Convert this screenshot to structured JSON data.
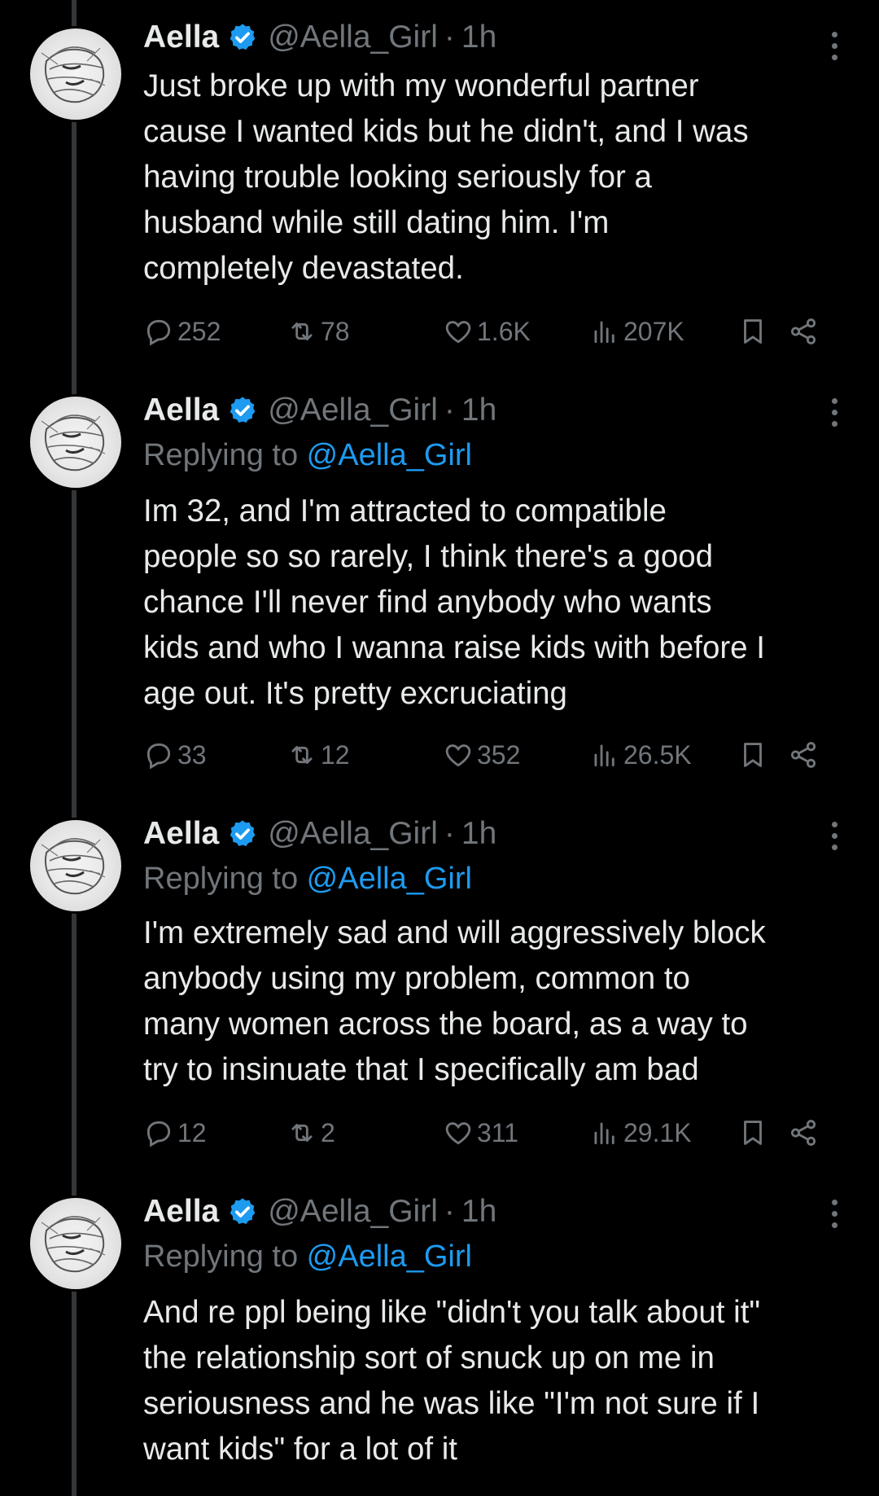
{
  "tweets": [
    {
      "name": "Aella",
      "handle": "@Aella_Girl",
      "separator": "·",
      "time": "1h",
      "replying_to": null,
      "text": "Just broke up with my wonderful partner\ncause I wanted kids but he didn't, and I was\nhaving trouble looking seriously for a\nhusband while still dating him. I'm\ncompletely devastated.",
      "replies": "252",
      "retweets": "78",
      "likes": "1.6K",
      "views": "207K"
    },
    {
      "name": "Aella",
      "handle": "@Aella_Girl",
      "separator": "·",
      "time": "1h",
      "replying_prefix": "Replying to ",
      "replying_to": "@Aella_Girl",
      "text": "Im 32, and I'm attracted to compatible\npeople so so rarely, I think there's a good\nchance I'll never find anybody who wants\nkids and who I wanna raise kids with before I\nage out. It's pretty excruciating",
      "replies": "33",
      "retweets": "12",
      "likes": "352",
      "views": "26.5K"
    },
    {
      "name": "Aella",
      "handle": "@Aella_Girl",
      "separator": "·",
      "time": "1h",
      "replying_prefix": "Replying to ",
      "replying_to": "@Aella_Girl",
      "text": "I'm extremely sad and will aggressively block\nanybody using my problem, common to\nmany women across the board, as a way to\ntry to insinuate that I specifically am bad",
      "replies": "12",
      "retweets": "2",
      "likes": "311",
      "views": "29.1K"
    },
    {
      "name": "Aella",
      "handle": "@Aella_Girl",
      "separator": "·",
      "time": "1h",
      "replying_prefix": "Replying to ",
      "replying_to": "@Aella_Girl",
      "text": "And re ppl being like \"didn't you talk about it\"\nthe relationship sort of snuck up on me in\nseriousness and he was like \"I'm not sure if I\nwant kids\" for a lot of it"
    }
  ],
  "icons": {
    "verified": "verified-badge-icon",
    "more": "more-options-icon",
    "reply": "reply-icon",
    "retweet": "retweet-icon",
    "like": "heart-icon",
    "views": "views-icon",
    "bookmark": "bookmark-icon",
    "share": "share-icon"
  },
  "colors": {
    "background": "#000000",
    "text": "#e7e9ea",
    "muted": "#71767b",
    "accent": "#1d9bf0",
    "thread_line": "#333639"
  }
}
